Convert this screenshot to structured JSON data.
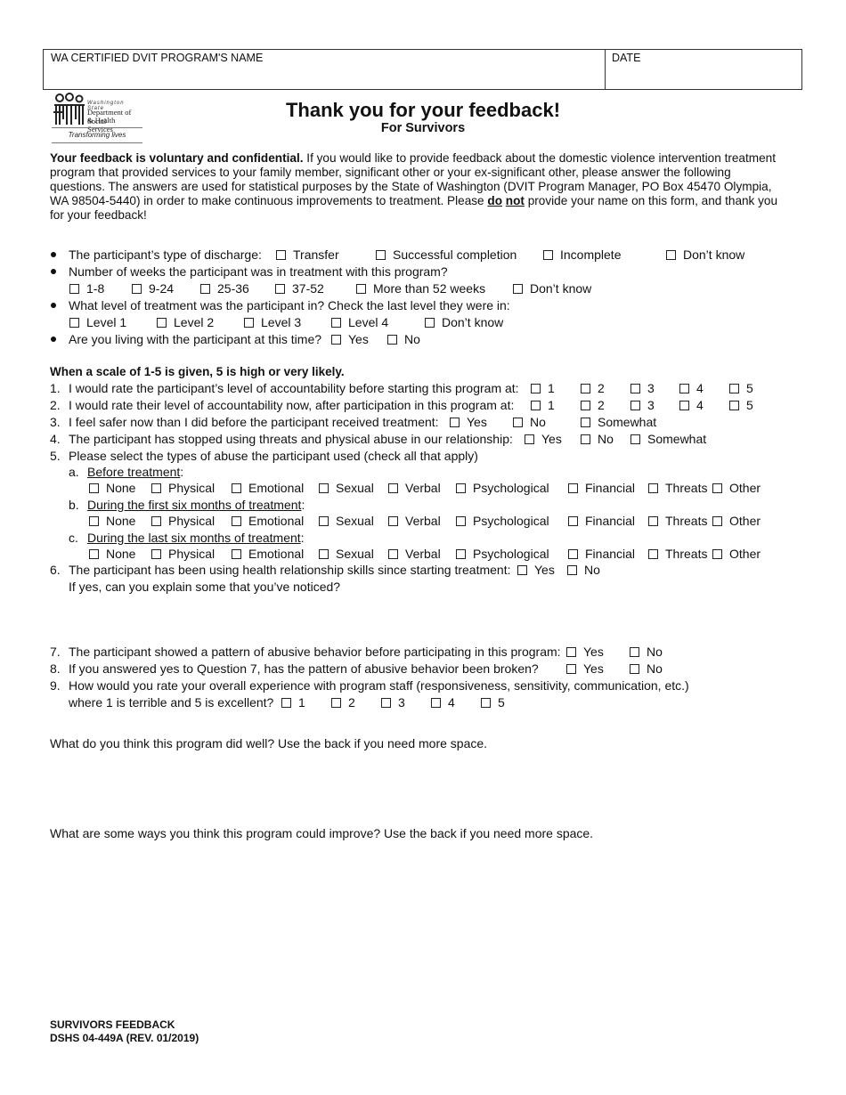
{
  "header": {
    "program_name_label": "WA CERTIFIED DVIT PROGRAM'S NAME",
    "date_label": "DATE"
  },
  "logo": {
    "state": "Washington State",
    "dept_line1": "Department of Social",
    "dept_line2": "& Health Services",
    "tagline": "Transforming lives"
  },
  "title": "Thank you for your feedback!",
  "subtitle": "For Survivors",
  "intro": {
    "bold_lead": "Your feedback is voluntary and confidential.",
    "text_before": " If you would like to provide feedback about the domestic violence intervention treatment program that provided services to your family member, significant other or your ex-significant other, please answer the following questions.  The answers are used for statistical purposes by the State of Washington (DVIT Program Manager, PO Box 45470 Olympia, WA 98504-5440) in order to make continuous improvements to treatment. Please ",
    "emph1": "do",
    "emph2": "not",
    "text_after": " provide your name on this form, and thank you for your feedback!"
  },
  "bullets": {
    "discharge": {
      "question": "The participant’s type of discharge:",
      "options": [
        "Transfer",
        "Successful completion",
        "Incomplete",
        "Don’t know"
      ]
    },
    "weeks": {
      "question": "Number of weeks the participant was in treatment with this program?",
      "options": [
        "1-8",
        "9-24",
        "25-36",
        "37-52",
        "More than 52 weeks",
        "Don’t know"
      ]
    },
    "level": {
      "question": "What level of treatment was the participant in?  Check the last level they were in:",
      "options": [
        "Level 1",
        "Level 2",
        "Level 3",
        "Level 4",
        "Don’t know"
      ]
    },
    "living": {
      "question": "Are you living with the participant at this time?",
      "options": [
        "Yes",
        "No"
      ]
    }
  },
  "scale_note": "When a scale of 1-5 is given, 5 is high or very likely.",
  "questions": {
    "q1": {
      "num": "1.",
      "text": "I would rate the participant’s level of accountability before starting this program at:",
      "options": [
        "1",
        "2",
        "3",
        "4",
        "5"
      ]
    },
    "q2": {
      "num": "2.",
      "text": "I would rate their level of accountability now, after participation in this program at:",
      "options": [
        "1",
        "2",
        "3",
        "4",
        "5"
      ]
    },
    "q3": {
      "num": "3.",
      "text": "I feel safer now than I did before the participant received treatment:",
      "options": [
        "Yes",
        "No",
        "Somewhat"
      ]
    },
    "q4": {
      "num": "4.",
      "text": "The participant has stopped using threats and physical abuse in our relationship:",
      "options": [
        "Yes",
        "No",
        "Somewhat"
      ]
    },
    "q5": {
      "num": "5.",
      "text": "Please select the types of abuse the participant used (check all that apply)",
      "abuse_types": [
        "None",
        "Physical",
        "Emotional",
        "Sexual",
        "Verbal",
        "Psychological",
        "Financial",
        "Threats",
        "Other"
      ],
      "periods": [
        {
          "letter": "a.",
          "label": "Before treatment",
          "suffix": ":"
        },
        {
          "letter": "b.",
          "label": "During the first six months of treatment",
          "suffix": ":"
        },
        {
          "letter": "c.",
          "label": "During the last six months of  treatment",
          "suffix": ":"
        }
      ]
    },
    "q6": {
      "num": "6.",
      "text": "The participant has been using health relationship skills since starting treatment:",
      "options": [
        "Yes",
        "No"
      ],
      "followup": "If yes, can you explain some that you’ve noticed?"
    },
    "q7": {
      "num": "7.",
      "text": "The participant showed a pattern of abusive behavior before participating in this program:",
      "options": [
        "Yes",
        "No"
      ]
    },
    "q8": {
      "num": "8.",
      "text": "If you answered yes to Question 7, has the pattern of abusive behavior been broken?",
      "options": [
        "Yes",
        "No"
      ]
    },
    "q9": {
      "num": "9.",
      "text": "How would you rate your overall experience with program staff (responsiveness, sensitivity, communication, etc.)",
      "text2": "where 1 is terrible and 5 is excellent?",
      "options": [
        "1",
        "2",
        "3",
        "4",
        "5"
      ]
    }
  },
  "open_questions": {
    "did_well": "What do you think this program did well?  Use the back if you need more space.",
    "improve": "What are some ways you think this program could improve?  Use the back if you need more space."
  },
  "footer": {
    "line1": "SURVIVORS FEEDBACK",
    "line2": "DSHS 04-449A (REV. 01/2019)"
  }
}
